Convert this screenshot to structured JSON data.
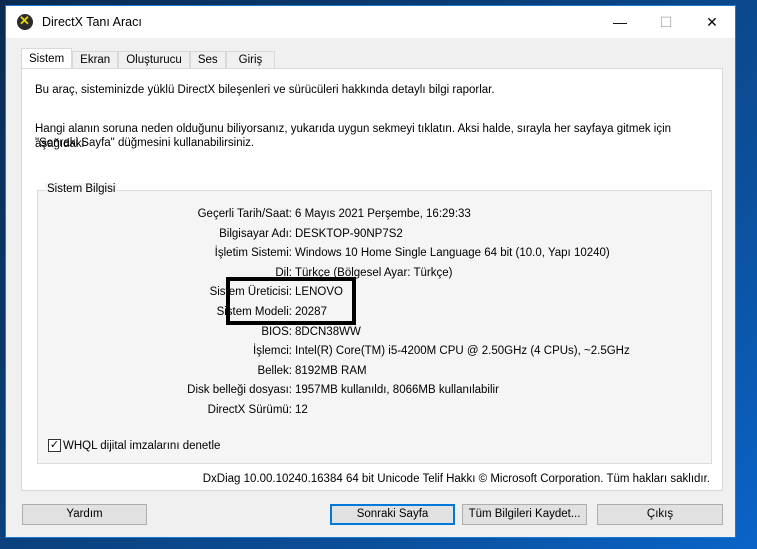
{
  "window": {
    "title": "DirectX Tanı Aracı",
    "minimize": "—",
    "maximize": "☐",
    "close": "✕"
  },
  "tabs": [
    {
      "label": "Sistem",
      "active": true
    },
    {
      "label": "Ekran"
    },
    {
      "label": "Oluşturucu"
    },
    {
      "label": "Ses"
    },
    {
      "label": "Giriş"
    }
  ],
  "intro1": "Bu araç, sisteminizde yüklü DirectX bileşenleri ve sürücüleri hakkında detaylı bilgi raporlar.",
  "intro2": "Hangi alanın soruna neden olduğunu biliyorsanız, yukarıda uygun sekmeyi tıklatın. Aksi halde, sırayla her sayfaya gitmek için aşağıdaki",
  "intro3": "\"Sonraki Sayfa\" düğmesini kullanabilirsiniz.",
  "group_title": "Sistem Bilgisi",
  "rows": [
    {
      "label": "Geçerli Tarih/Saat:",
      "value": "6 Mayıs 2021 Perşembe, 16:29:33"
    },
    {
      "label": "Bilgisayar Adı:",
      "value": "DESKTOP-90NP7S2"
    },
    {
      "label": "İşletim Sistemi:",
      "value": "Windows 10 Home Single Language 64 bit (10.0, Yapı 10240)"
    },
    {
      "label": "Dil:",
      "value": "Türkçe (Bölgesel Ayar: Türkçe)"
    },
    {
      "label": "Sistem Üreticisi:",
      "value": "LENOVO"
    },
    {
      "label": "Sistem Modeli:",
      "value": "20287"
    },
    {
      "label": "BIOS:",
      "value": "8DCN38WW"
    },
    {
      "label": "İşlemci:",
      "value": "Intel(R) Core(TM) i5-4200M CPU @ 2.50GHz (4 CPUs), ~2.5GHz"
    },
    {
      "label": "Bellek:",
      "value": "8192MB RAM"
    },
    {
      "label": "Disk belleği dosyası:",
      "value": "1957MB kullanıldı, 8066MB kullanılabilir"
    },
    {
      "label": "DirectX Sürümü:",
      "value": "12"
    }
  ],
  "whql": {
    "label": "WHQL dijital imzalarını denetle",
    "checked": true,
    "mark": "✓"
  },
  "footer": "DxDiag 10.00.10240.16384 64 bit Unicode  Telif Hakkı © Microsoft Corporation. Tüm hakları saklıdır.",
  "buttons": {
    "help": "Yardım",
    "next": "Sonraki Sayfa",
    "save": "Tüm Bilgileri Kaydet...",
    "exit": "Çıkış"
  }
}
